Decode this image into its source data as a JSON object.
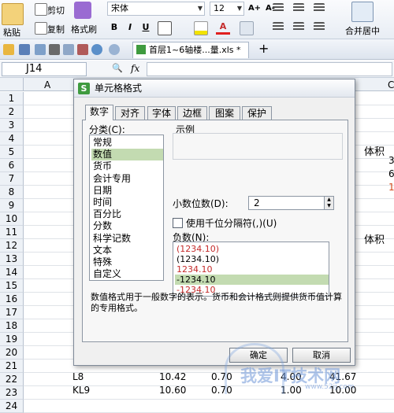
{
  "ribbon": {
    "cut_label": "剪切",
    "copy_label": "复制",
    "paste_label": "粘贴",
    "format_painter_label": "格式刷",
    "font_name": "宋体",
    "font_size": "12",
    "merge_label": "合并居中",
    "bold": "B",
    "italic": "I",
    "underline": "U",
    "grow_font": "A+",
    "shrink_font": "A-",
    "font_color_letter": "A",
    "dropdown_arrow": "▼"
  },
  "toolbar": {
    "document_tab": "首层1~6轴楼...量.xls *",
    "new_tab_symbol": "+"
  },
  "formula_bar": {
    "cell_ref": "J14",
    "search_symbol": "🔍",
    "fx_label": "fx"
  },
  "grid": {
    "column_a": "A",
    "column_right": "C",
    "rows": [
      "1",
      "2",
      "3",
      "4",
      "5",
      "6",
      "7",
      "8",
      "9",
      "10",
      "11",
      "12",
      "13",
      "14",
      "15",
      "16",
      "17",
      "18",
      "19",
      "20",
      "21",
      "22",
      "23",
      "24"
    ],
    "visible_cells": {
      "r5": "体积",
      "r12": "体积",
      "r6_edge": "3",
      "r7_edge": "6",
      "r8_edge": "1"
    },
    "bottom_row_1": [
      "L8",
      "10.42",
      "0.70",
      "4.00",
      "41.67"
    ],
    "bottom_row_2": [
      "KL9",
      "10.60",
      "0.70",
      "1.00",
      "10.00"
    ]
  },
  "dialog": {
    "title": "单元格格式",
    "logo_letter": "S",
    "tabs": [
      "数字",
      "对齐",
      "字体",
      "边框",
      "图案",
      "保护"
    ],
    "active_tab": "数字",
    "category_label": "分类(C):",
    "categories": [
      "常规",
      "数值",
      "货币",
      "会计专用",
      "日期",
      "时间",
      "百分比",
      "分数",
      "科学记数",
      "文本",
      "特殊",
      "自定义"
    ],
    "selected_category": "数值",
    "sample_label": "示例",
    "decimal_label": "小数位数(D):",
    "decimal_value": "2",
    "spin_up": "▲",
    "spin_down": "▼",
    "thousands_label": "使用千位分隔符(,)(U)",
    "negative_label": "负数(N):",
    "negative_options": [
      "(1234.10)",
      "(1234.10)",
      "1234.10",
      "-1234.10",
      "-1234.10"
    ],
    "negative_red": [
      true,
      false,
      true,
      false,
      true
    ],
    "selected_negative": 3,
    "description": "数值格式用于一般数字的表示。货币和会计格式则提供货币值计算的专用格式。",
    "ok_label": "确定",
    "cancel_label": "取消"
  },
  "watermark": {
    "text": "我爱IT技术网",
    "url": "www.52ij.com"
  }
}
